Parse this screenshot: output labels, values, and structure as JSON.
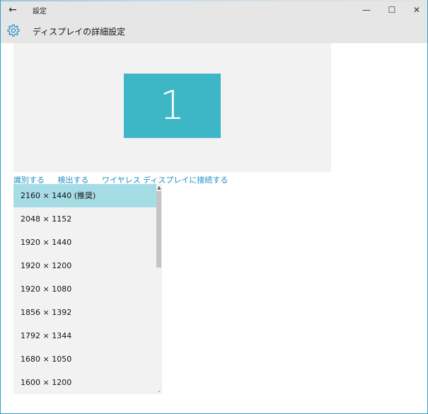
{
  "window": {
    "title": "設定",
    "back_icon": "back-arrow-icon",
    "min_glyph": "—",
    "max_glyph": "☐",
    "close_glyph": "✕"
  },
  "header": {
    "icon": "gear-icon",
    "title": "ディスプレイの詳細設定"
  },
  "display_preview": {
    "monitor_number": "1",
    "monitor_color": "#3db6c6"
  },
  "links": [
    "識別する",
    "検出する",
    "ワイヤレス ディスプレイに接続する"
  ],
  "resolutions": {
    "selected_index": 0,
    "options": [
      "2160 × 1440 (推奨)",
      "2048 × 1152",
      "1920 × 1440",
      "1920 × 1200",
      "1920 × 1080",
      "1856 × 1392",
      "1792 × 1344",
      "1680 × 1050",
      "1600 × 1200"
    ]
  },
  "colors": {
    "accent": "#1c8fc2",
    "selected": "#a6dce6",
    "titlebar": "#e6e6e6"
  }
}
